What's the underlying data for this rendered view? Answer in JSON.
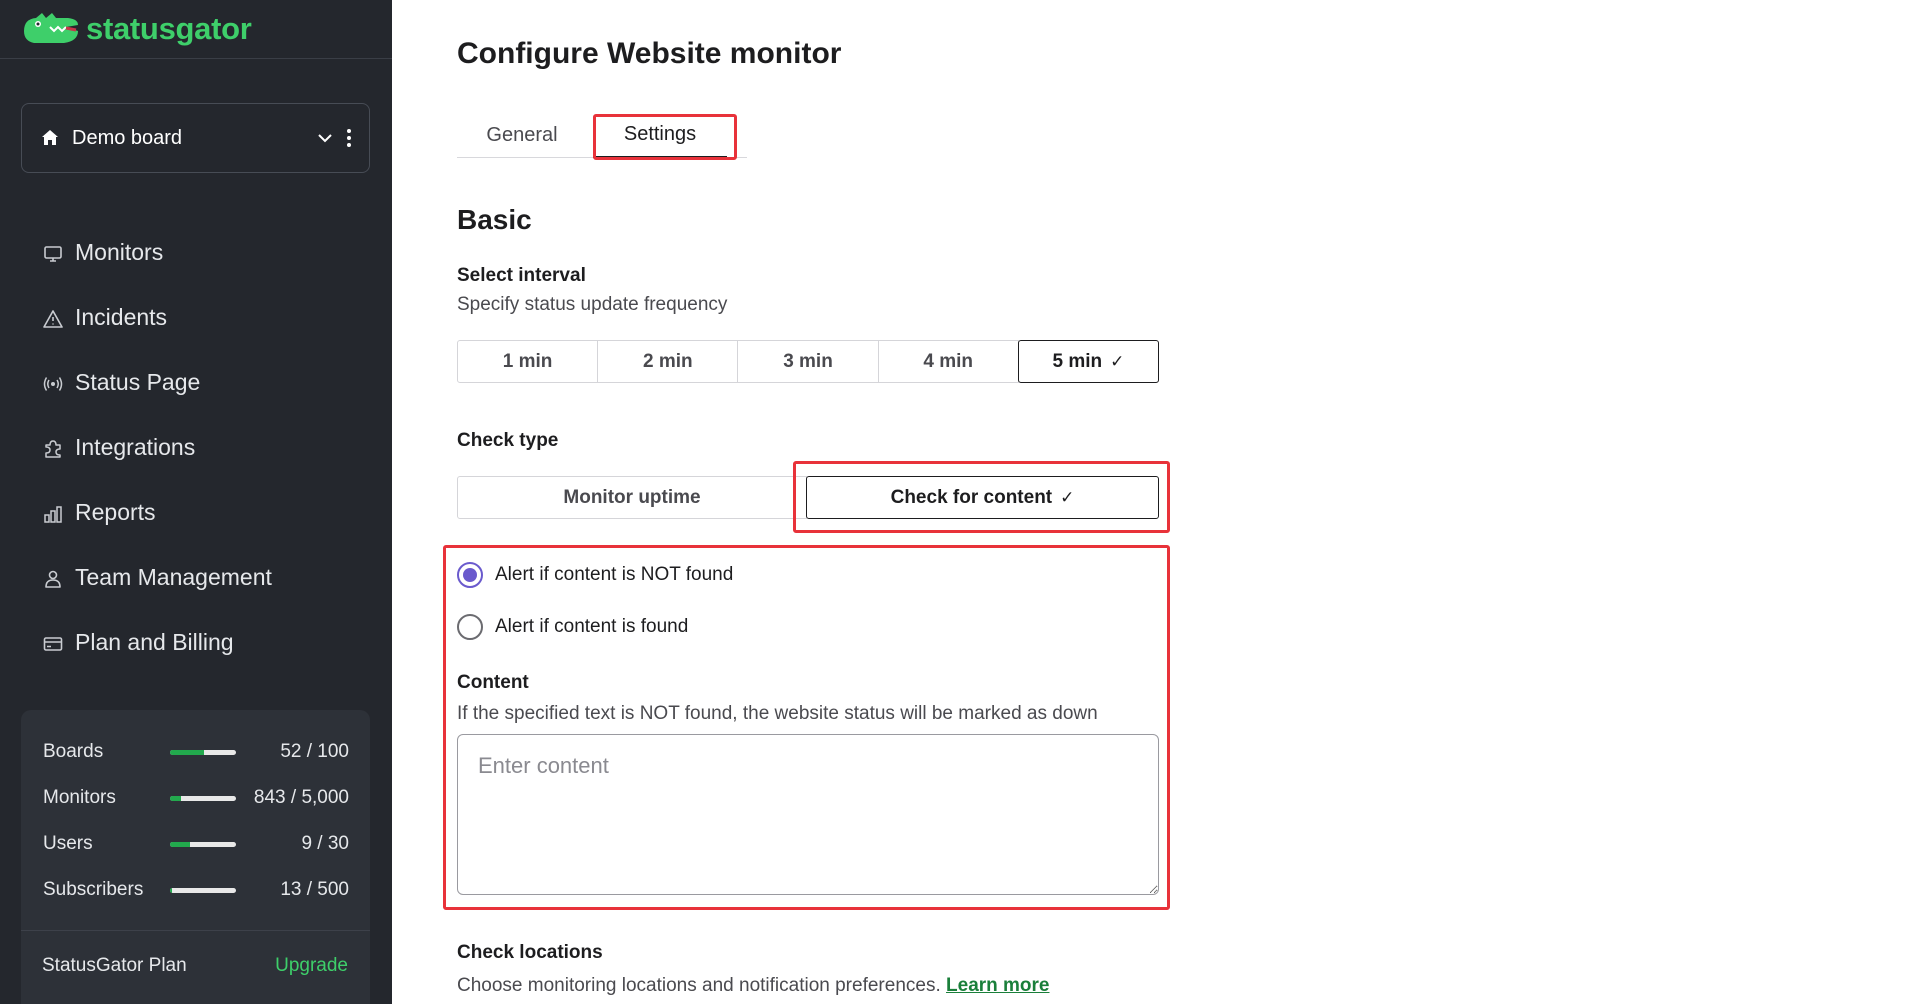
{
  "brand": {
    "name": "statusgator"
  },
  "board_selector": {
    "label": "Demo board"
  },
  "nav": {
    "items": [
      {
        "label": "Monitors",
        "icon": "monitor-icon"
      },
      {
        "label": "Incidents",
        "icon": "warning-icon"
      },
      {
        "label": "Status Page",
        "icon": "broadcast-icon"
      },
      {
        "label": "Integrations",
        "icon": "puzzle-icon"
      },
      {
        "label": "Reports",
        "icon": "bar-chart-icon"
      },
      {
        "label": "Team Management",
        "icon": "user-icon"
      },
      {
        "label": "Plan and Billing",
        "icon": "credit-card-icon"
      }
    ]
  },
  "usage": {
    "rows": [
      {
        "label": "Boards",
        "value": "52 / 100",
        "fraction": 0.52
      },
      {
        "label": "Monitors",
        "value": "843 / 5,000",
        "fraction": 0.17
      },
      {
        "label": "Users",
        "value": "9 / 30",
        "fraction": 0.3
      },
      {
        "label": "Subscribers",
        "value": "13 / 500",
        "fraction": 0.03
      }
    ],
    "plan_name": "StatusGator Plan",
    "upgrade_label": "Upgrade"
  },
  "page": {
    "title": "Configure Website monitor"
  },
  "tabs": {
    "general": "General",
    "settings": "Settings"
  },
  "basic": {
    "heading": "Basic",
    "interval_label": "Select interval",
    "interval_help": "Specify status update frequency",
    "intervals": [
      "1 min",
      "2 min",
      "3 min",
      "4 min",
      "5 min"
    ],
    "selected_interval": "5 min",
    "check_mark": "✓"
  },
  "check_type": {
    "label": "Check type",
    "uptime": "Monitor uptime",
    "content": "Check for content",
    "selected": "Check for content"
  },
  "content_options": {
    "not_found": "Alert if content is NOT found",
    "found": "Alert if content is found",
    "selected": "not_found"
  },
  "content": {
    "label": "Content",
    "help": "If the specified text is NOT found, the website status will be marked as down",
    "placeholder": "Enter content",
    "value": ""
  },
  "locations": {
    "label": "Check locations",
    "help": "Choose monitoring locations and notification preferences.",
    "link": "Learn more"
  },
  "colors": {
    "sidebar_bg": "#24272d",
    "brand_green": "#3ecf6a",
    "radio_purple": "#6a5acd",
    "highlight_red": "#e8323a",
    "link_green": "#1a7f3a"
  }
}
